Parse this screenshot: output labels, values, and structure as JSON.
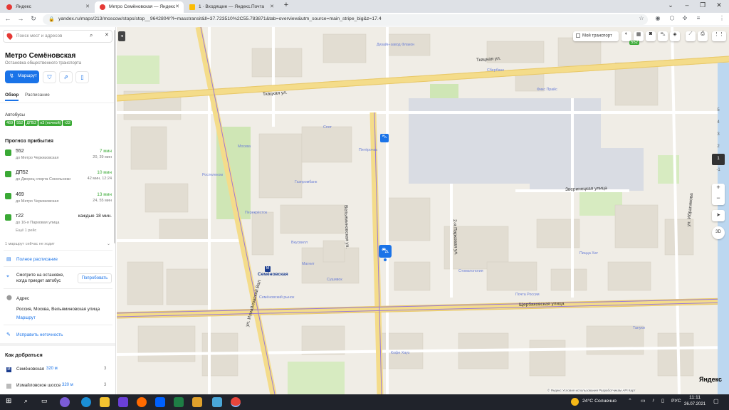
{
  "browser": {
    "tabs": [
      {
        "title": "Яндекс",
        "color": "#e53935"
      },
      {
        "title": "Метро Семёновская — Яндекс",
        "color": "#e53935"
      },
      {
        "title": "1 · Входящие — Яндекс.Почта",
        "color": "#fbbc04"
      }
    ],
    "url": "yandex.ru/maps/213/moscow/stops/stop__9642804/?l=masstransit&ll=37.723510%2C55.783871&tab=overview&utm_source=main_stripe_big&z=17.4"
  },
  "sidebar": {
    "search_placeholder": "Поиск мест и адресов",
    "title": "Метро Семёновская",
    "subtitle": "Остановка общественного транспорта",
    "route_button": "Маршрут",
    "tabs": [
      "Обзор",
      "Расписание"
    ],
    "buses_label": "Автобусы",
    "bus_badges": [
      "469",
      "552",
      "ДП52",
      "н3 (ночной)",
      "т22"
    ],
    "forecast_label": "Прогноз прибытия",
    "arrivals": [
      {
        "route": "552",
        "dest": "до Метро Черкизовская",
        "eta": "7 мин",
        "times": "20, 39 мин"
      },
      {
        "route": "ДП52",
        "dest": "до Дворец спорта Сокольники",
        "eta": "10 мин",
        "times": "42 мин, 12:24"
      },
      {
        "route": "469",
        "dest": "до Метро Черкизовская",
        "eta": "13 мин",
        "times": "24, 55 мин"
      },
      {
        "route": "т22",
        "dest": "до 16-я Парковая улица",
        "eta": "каждые 18 мин.",
        "times": ""
      }
    ],
    "more_trip": "Ещё 1 рейс",
    "route_now": "1 маршрут сейчас не ходит",
    "full_schedule": "Полное расписание",
    "promo_text": "Смотрите на остановке, когда приедет автобус",
    "promo_button": "Попробовать",
    "address_label": "Адрес",
    "address": "Россия, Москва, Вельяминовская улица",
    "address_route": "Маршрут",
    "fix_link": "Исправить неточность",
    "how_to_get": "Как добраться",
    "metro": [
      {
        "name": "Семёновская",
        "dist": "320 м",
        "num": "3"
      },
      {
        "name": "Измайловское шоссе",
        "dist": "320 м",
        "num": "3"
      }
    ]
  },
  "map": {
    "my_transport": "Мой транспорт",
    "streets": {
      "tkatskaya_top": "Ткацкая ул.",
      "tkatskaya_left": "Ткацкая ул.",
      "shcherbakovskaya": "Щербаковская улица",
      "velyaminovskaya": "Вельяминовская ул.",
      "izmailovsky_val": "ул. Измайловский Вал",
      "zverinetskaya": "Зверинецкая улица",
      "ibragimova": "ул. Ибрагимова",
      "parkovaya": "2-я Парковая ул."
    },
    "metro_label": "Семёновская",
    "bus_label": "552",
    "pois": [
      "Дизайн-завод Флакон",
      "Сбербанк",
      "Спот",
      "Пятёрочка",
      "Газпромбанк",
      "Ростелеком",
      "Москва",
      "Перекрёсток",
      "Вкусвилл",
      "Пицца Хат",
      "Почта России",
      "Стоматология",
      "Магнит",
      "Сушивок",
      "Кофе Хауз",
      "Фикс Прайс",
      "Семёновский рынок",
      "Тануки"
    ],
    "zoom_levels": [
      "5",
      "4",
      "3",
      "2",
      "1",
      "-1"
    ],
    "active_zoom": "1",
    "copyright": "© Яндекс  Условия использования  Разработчикам  API Карт"
  },
  "taskbar": {
    "weather": "24°C  Солнечно",
    "lang": "РУС",
    "time": "11:11",
    "date": "26.07.2021"
  }
}
